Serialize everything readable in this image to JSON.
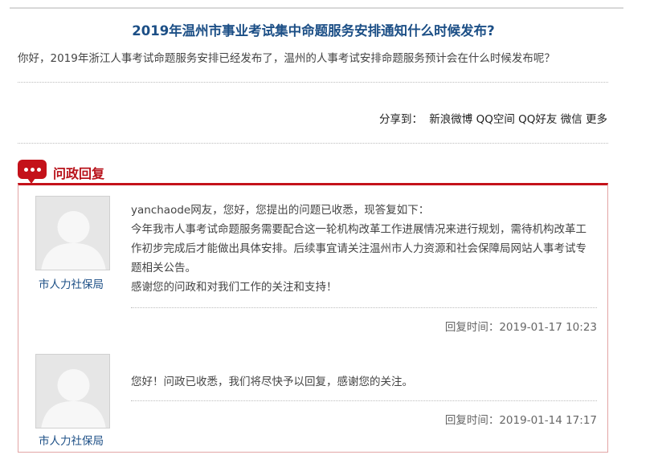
{
  "question": {
    "title": "2019年温州市事业考试集中命题服务安排通知什么时候发布?",
    "body": "你好，2019年浙江人事考试命题服务安排已经发布了，温州的人事考试安排命题服务预计会在什么时候发布呢？"
  },
  "share": {
    "label": "分享到：",
    "links": [
      "新浪微博",
      "QQ空间",
      "QQ好友",
      "微信",
      "更多"
    ]
  },
  "reply_section": {
    "title": "问政回复"
  },
  "replies": [
    {
      "org": "市人力社保局",
      "lines": [
        "yanchaode网友，您好，您提出的问题已收悉，现答复如下：",
        "今年我市人事考试命题服务需要配合这一轮机构改革工作进展情况来进行规划，需待机构改革工作初步完成后才能做出具体安排。后续事宜请关注温州市人力资源和社会保障局网站人事考试专题相关公告。",
        "感谢您的问政和对我们工作的关注和支持！"
      ],
      "time": "回复时间：2019-01-17 10:23"
    },
    {
      "org": "市人力社保局",
      "lines": [
        "您好！问政已收悉，我们将尽快予以回复，感谢您的关注。"
      ],
      "time": "回复时间：2019-01-14 17:17"
    }
  ],
  "colors": {
    "title": "#1c4f86",
    "accent": "#c4121a"
  }
}
